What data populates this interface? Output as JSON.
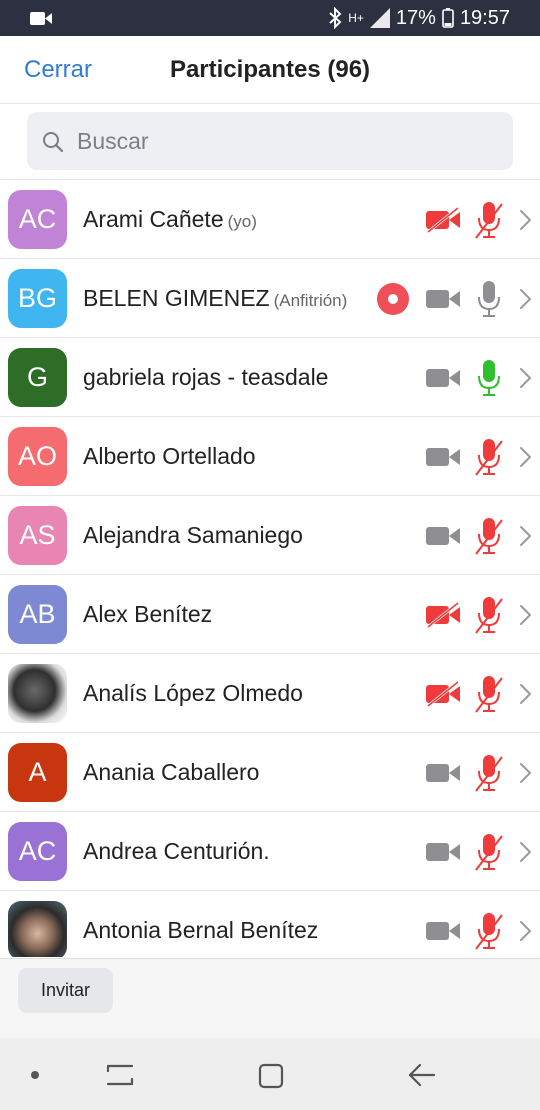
{
  "status_bar": {
    "battery": "17%",
    "time": "19:57",
    "network": "H+"
  },
  "header": {
    "close_label": "Cerrar",
    "title": "Participantes (96)"
  },
  "search": {
    "placeholder": "Buscar",
    "value": ""
  },
  "participants": [
    {
      "initials": "AC",
      "name": "Arami Cañete",
      "tag": "(yo)",
      "avatar_color": "#c083d6",
      "video": "off",
      "mic": "muted"
    },
    {
      "initials": "BG",
      "name": "BELEN GIMENEZ",
      "tag": "(Anfitrión)",
      "avatar_color": "#3fb6ef",
      "video": "on",
      "mic": "on",
      "recording": true
    },
    {
      "initials": "G",
      "name": "gabriela rojas - teasdale",
      "tag": "",
      "avatar_color": "#2e6d27",
      "video": "on",
      "mic": "speaking"
    },
    {
      "initials": "AO",
      "name": "Alberto Ortellado",
      "tag": "",
      "avatar_color": "#f56c70",
      "video": "on",
      "mic": "muted"
    },
    {
      "initials": "AS",
      "name": "Alejandra Samaniego",
      "tag": "",
      "avatar_color": "#e985b2",
      "video": "on",
      "mic": "muted"
    },
    {
      "initials": "AB",
      "name": "Alex Benítez",
      "tag": "",
      "avatar_color": "#7d8ad3",
      "video": "off",
      "mic": "muted"
    },
    {
      "initials": "",
      "name": "Analís López Olmedo",
      "tag": "",
      "avatar_color": "#555555",
      "avatar_photo": "photo1",
      "video": "off",
      "mic": "muted"
    },
    {
      "initials": "A",
      "name": "Anania Caballero",
      "tag": "",
      "avatar_color": "#c8360f",
      "video": "on",
      "mic": "muted"
    },
    {
      "initials": "AC",
      "name": "Andrea Centurión.",
      "tag": "",
      "avatar_color": "#9a72d5",
      "video": "on",
      "mic": "muted"
    },
    {
      "initials": "",
      "name": "Antonia Bernal Benítez",
      "tag": "",
      "avatar_color": "#6b6b6b",
      "avatar_photo": "photo2",
      "video": "on",
      "mic": "muted"
    }
  ],
  "footer": {
    "invite_label": "Invitar"
  },
  "colors": {
    "accent": "#2f7bd6",
    "muted_red": "#ef3b3b",
    "speaking_green": "#2ec02e",
    "icon_gray": "#8e8e93"
  }
}
